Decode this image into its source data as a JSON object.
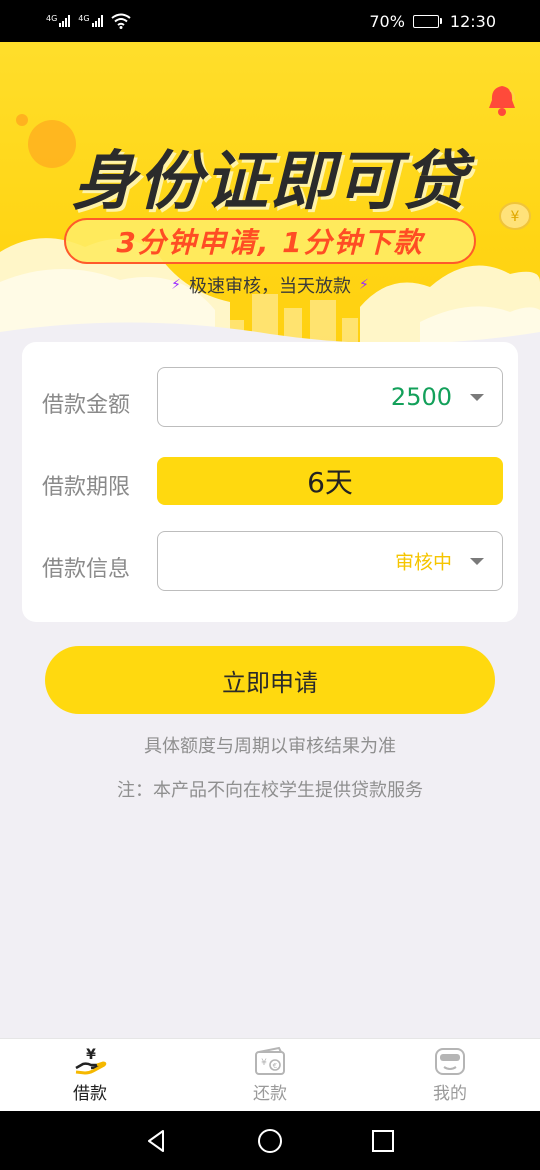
{
  "status_bar": {
    "net1": "4G",
    "net2": "4G",
    "battery_percent": "70%",
    "battery_level": 0.7,
    "time": "12:30"
  },
  "banner": {
    "title": "身份证即可贷",
    "subtitle": "3分钟申请, 1分钟下款",
    "tagline": "极速审核，当天放款"
  },
  "form": {
    "amount": {
      "label": "借款金额",
      "value": "2500"
    },
    "period": {
      "label": "借款期限",
      "value": "6天"
    },
    "info": {
      "label": "借款信息",
      "value": "审核中"
    }
  },
  "apply_button": "立即申请",
  "notes": {
    "line1": "具体额度与周期以审核结果为准",
    "line2": "注：本产品不向在校学生提供贷款服务"
  },
  "tabs": [
    {
      "label": "借款",
      "icon": "loan-hand-icon",
      "active": true
    },
    {
      "label": "还款",
      "icon": "repay-wallet-icon",
      "active": false
    },
    {
      "label": "我的",
      "icon": "profile-icon",
      "active": false
    }
  ],
  "colors": {
    "brand_yellow": "#ffd90f",
    "amount_green": "#13a05a",
    "status_yellow": "#f5c500",
    "subtitle_red": "#ff4d24"
  }
}
